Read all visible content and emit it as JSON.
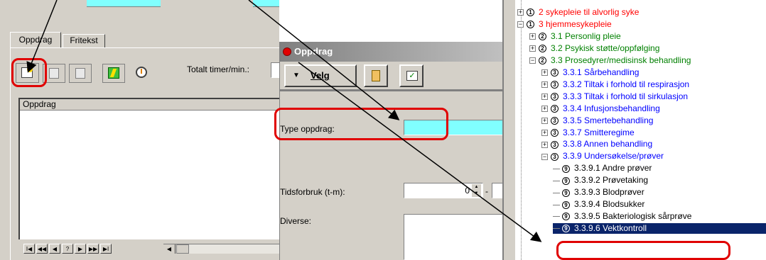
{
  "left_panel": {
    "tabs": [
      "Oppdrag",
      "Fritekst"
    ],
    "total_label": "Totalt timer/min.:",
    "list_header": "Oppdrag",
    "nav_buttons": [
      "I◀",
      "◀◀",
      "◀",
      "?",
      "▶",
      "▶▶",
      "▶I"
    ]
  },
  "dialog": {
    "title": "Oppdrag",
    "velg_label": "Velg",
    "type_label": "Type oppdrag:",
    "type_value": "",
    "tids_label": "Tidsforbruk (t-m):",
    "tids_value": "0",
    "diverse_label": "Diverse:"
  },
  "tree": {
    "items": [
      {
        "expander": "+",
        "level": "1",
        "text": "2 sykepleie til alvorlig syke",
        "color": "#ff0000"
      },
      {
        "expander": "−",
        "level": "1",
        "text": "3 hjemmesykepleie",
        "color": "#ff0000"
      },
      {
        "expander": "+",
        "level": "2",
        "text": "3.1 Personlig pleie",
        "color": "#008000"
      },
      {
        "expander": "+",
        "level": "2",
        "text": "3.2 Psykisk støtte/oppfølging",
        "color": "#008000"
      },
      {
        "expander": "−",
        "level": "2",
        "text": "3.3 Prosedyrer/medisinsk behandling",
        "color": "#008000"
      },
      {
        "expander": "+",
        "level": "3",
        "text": "3.3.1 Sårbehandling",
        "color": "#0000ff"
      },
      {
        "expander": "+",
        "level": "3",
        "text": "3.3.2 Tiltak i forhold til respirasjon",
        "color": "#0000ff"
      },
      {
        "expander": "+",
        "level": "3",
        "text": "3.3.3 Tiltak i forhold til sirkulasjon",
        "color": "#0000ff"
      },
      {
        "expander": "+",
        "level": "3",
        "text": "3.3.4 Infusjonsbehandling",
        "color": "#0000ff"
      },
      {
        "expander": "+",
        "level": "3",
        "text": "3.3.5 Smertebehandling",
        "color": "#0000ff"
      },
      {
        "expander": "+",
        "level": "3",
        "text": "3.3.7 Smitteregime",
        "color": "#0000ff"
      },
      {
        "expander": "+",
        "level": "3",
        "text": "3.3.8 Annen behandling",
        "color": "#0000ff"
      },
      {
        "expander": "−",
        "level": "3",
        "text": "3.3.9 Undersøkelse/prøver",
        "color": "#0000ff"
      },
      {
        "expander": "",
        "level": "9",
        "text": "3.3.9.1 Andre prøver",
        "color": "#000000"
      },
      {
        "expander": "",
        "level": "9",
        "text": "3.3.9.2 Prøvetaking",
        "color": "#000000"
      },
      {
        "expander": "",
        "level": "9",
        "text": "3.3.9.3 Blodprøver",
        "color": "#000000"
      },
      {
        "expander": "",
        "level": "9",
        "text": "3.3.9.4 Blodsukker",
        "color": "#000000"
      },
      {
        "expander": "",
        "level": "9",
        "text": "3.3.9.5 Bakteriologisk sårprøve",
        "color": "#000000"
      },
      {
        "expander": "",
        "level": "9",
        "text": "3.3.9.6 Vektkontroll",
        "color": "#ffffff",
        "selected": true
      }
    ]
  },
  "colors": {
    "window_bg": "#d4d0c8",
    "cyan_field": "#80ffff",
    "annotation_red": "#e00000",
    "selection_navy": "#0a246a"
  }
}
